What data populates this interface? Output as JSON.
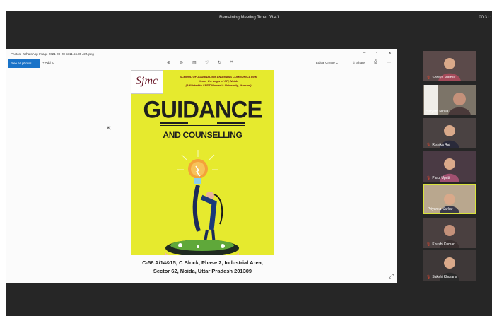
{
  "meeting": {
    "remaining_time": "Remaining Meeting Time: 03:41",
    "clock": "00:31:"
  },
  "photos": {
    "window_title": "Photos - WhatsApp Image 2021-09-28 at 11.56.39 AM.jpeg",
    "see_all": "See all photos",
    "add_to": "+ Add to",
    "edit_create": "Edit & Create",
    "share": "Share",
    "icons": [
      "zoom-in-icon",
      "zoom-out-icon",
      "delete-icon",
      "favorite-icon",
      "rotate-icon",
      "crop-icon"
    ]
  },
  "poster": {
    "logo": "Sjmc",
    "line1": "SCHOOL OF JOURNALISM AND MASS COMMUNICATION",
    "line2": "Under the aegis of SFI, Noida",
    "line3": "(Affiliated to SNDT Women's University, Mumbai)",
    "title": "GUIDANCE",
    "subtitle": "AND COUNSELLING",
    "address1": "C-56 A/14&15, C Block, Phase 2, Industrial Area,",
    "address2": "Sector 62, Noida, Uttar Pradesh 201309"
  },
  "participants": [
    {
      "name": "Shreya Mathur",
      "muted": true
    },
    {
      "name": "Satyam Nirala",
      "muted": false
    },
    {
      "name": "Rishika Raj",
      "muted": true
    },
    {
      "name": "Parul Upriti",
      "muted": true
    },
    {
      "name": "Priyanka Sarkar",
      "muted": false
    },
    {
      "name": "Khushi Kumari",
      "muted": true
    },
    {
      "name": "Sakshi Khurana",
      "muted": true
    }
  ]
}
